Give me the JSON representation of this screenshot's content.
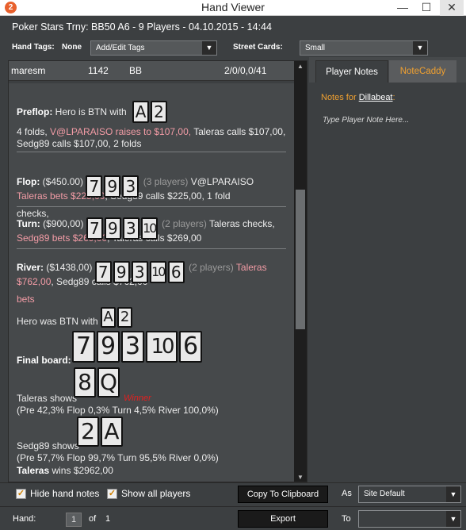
{
  "window": {
    "title": "Hand Viewer",
    "app_icon": "2",
    "minimize_glyph": "—",
    "maximize_glyph": "☐",
    "close_glyph": "✕"
  },
  "header": {
    "tournament": "Poker Stars Trny: BB50 A6 - 9 Players - 04.10.2015 - 14:44",
    "hand_tags_label": "Hand Tags:",
    "hand_tags_value": "None",
    "add_edit_tags": "Add/Edit Tags",
    "street_cards_label": "Street Cards:",
    "street_cards_value": "Small"
  },
  "player_row": {
    "name": "maresm",
    "number": "1142",
    "position": "BB",
    "stats": "2/0/0,0/41"
  },
  "hand": {
    "preflop": {
      "label": "Preflop:",
      "intro": " Hero is BTN with",
      "cards": [
        "A",
        "2"
      ],
      "line1_a": "4 folds, ",
      "line1_red": "V@LPARAISO raises to $107,00,",
      "line1_b": " Taleras calls $107,00,",
      "line2": "Sedg89 calls $107,00, 2 folds"
    },
    "flop": {
      "label": "Flop:",
      "pot": " ($450.00)",
      "cards": [
        "7",
        "9",
        "3"
      ],
      "players": "(3 players)",
      "action_a": " V@LPARAISO checks,",
      "line2_red": "Taleras bets $225,00",
      "line2_b": ", Sedg89 calls $225,00, 1 fold"
    },
    "turn": {
      "label": "Turn:",
      "pot": " ($900,00)",
      "cards": [
        "7",
        "9",
        "3",
        "10"
      ],
      "players": "(2 players)",
      "action_a": " Taleras checks,",
      "line2_red": "Sedg89 bets $269,00",
      "line2_b": ", Taleras calls $269,00"
    },
    "river": {
      "label": "River:",
      "pot": " ($1438,00)",
      "cards": [
        "7",
        "9",
        "3",
        "10",
        "6"
      ],
      "players": "(2 players)",
      "action_red_a": " Taleras bets",
      "line2_red": "$762,00",
      "line2_b": ", Sedg89 calls $762,00"
    },
    "summary": {
      "hero_text": "Hero was BTN with",
      "hero_cards": [
        "A",
        "2"
      ],
      "final_board_label": "Final board:",
      "final_board": [
        "7",
        "9",
        "3",
        "10",
        "6"
      ],
      "taleras_shows": "Taleras shows",
      "taleras_cards": [
        "8",
        "Q"
      ],
      "winner_label": "Winner",
      "taleras_equity": "(Pre 42,3% Flop 0,3% Turn 4,5% River 100,0%)",
      "sedg_shows": "Sedg89 shows",
      "sedg_cards": [
        "2",
        "A"
      ],
      "sedg_equity": "(Pre 57,7% Flop 99,7% Turn 95,5% River 0,0%)",
      "wins_name": "Taleras",
      "wins_text": " wins $2962,00"
    }
  },
  "right_pane": {
    "tab_player_notes": "Player Notes",
    "tab_notecaddy": "NoteCaddy",
    "notes_for_label": "Notes for ",
    "notes_for_name": "Dillabeat",
    "notes_for_colon": ":",
    "note_placeholder": "Type Player Note Here..."
  },
  "bottom": {
    "hide_hand_notes": "Hide hand notes",
    "show_all_players": "Show all players",
    "copy_clipboard": "Copy To Clipboard",
    "as_label": "As",
    "site_default": "Site Default",
    "hand_label": "Hand:",
    "hand_current": "1",
    "of_label": "of",
    "hand_total": "1",
    "export": "Export",
    "to_label": "To",
    "to_value": ""
  },
  "colors": {
    "background": "#3c3f41",
    "content": "#46494b",
    "accent_orange": "#f0a030",
    "action_red": "#f39ca6",
    "winner_red": "#e02020"
  }
}
